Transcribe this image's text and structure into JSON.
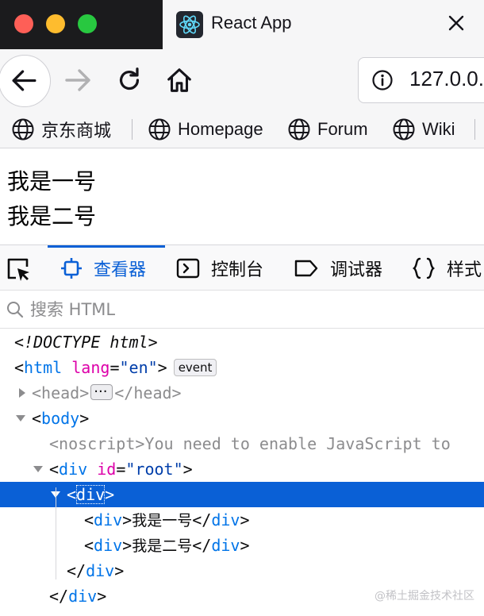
{
  "window": {
    "tab_title": "React App",
    "url": "127.0.0."
  },
  "icons": {
    "back": "arrow-left-icon",
    "forward": "arrow-right-icon",
    "reload": "reload-icon",
    "home": "home-icon",
    "info": "info-icon",
    "globe": "globe-icon",
    "react": "react-logo-icon"
  },
  "bookmarks": [
    {
      "label": "京东商城"
    },
    {
      "label": "Homepage"
    },
    {
      "label": "Forum"
    },
    {
      "label": "Wiki"
    }
  ],
  "page": {
    "lines": [
      "我是一号",
      "我是二号"
    ]
  },
  "devtools": {
    "tabs": [
      {
        "label": "查看器"
      },
      {
        "label": "控制台"
      },
      {
        "label": "调试器"
      },
      {
        "label": "样式"
      }
    ],
    "search_placeholder": "搜索 HTML",
    "doctype": "<!DOCTYPE html>",
    "html_tag": "html",
    "html_attr": "lang",
    "html_attr_value": "\"en\"",
    "event_badge": "event",
    "head_tag": "head",
    "body_tag": "body",
    "noscript_tag": "noscript",
    "noscript_text": "You need to enable JavaScript to",
    "div_tag": "div",
    "div_attr": "id",
    "div_attr_value": "\"root\"",
    "inner_texts": [
      "我是一号",
      "我是二号"
    ]
  },
  "watermark": "@稀土掘金技术社区",
  "colors": {
    "accent": "#0a60d6",
    "tag": "#0074e8",
    "attr": "#dd00a9"
  }
}
